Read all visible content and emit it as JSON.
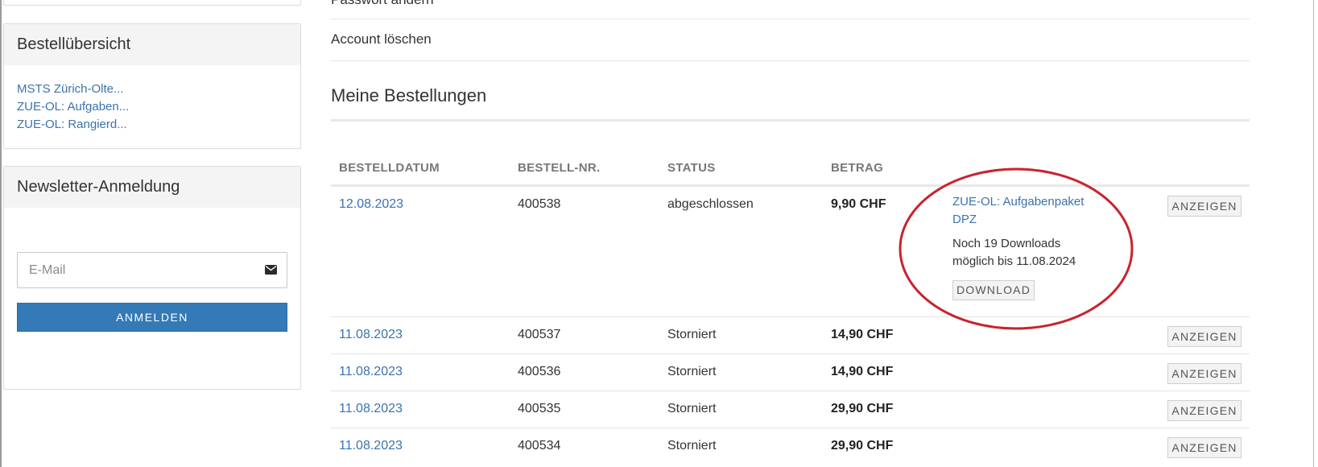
{
  "sidebar": {
    "orders_panel": {
      "title": "Bestellübersicht",
      "links": [
        "MSTS Zürich-Olte...",
        "ZUE-OL: Aufgaben...",
        "ZUE-OL: Rangierd..."
      ]
    },
    "newsletter_panel": {
      "title": "Newsletter-Anmeldung",
      "email_placeholder": "E-Mail",
      "email_value": "",
      "email_icon": "envelope-icon",
      "subscribe_label": "ANMELDEN"
    }
  },
  "account_menu": {
    "change_password": "Passwort ändern",
    "delete_account": "Account löschen"
  },
  "orders": {
    "title": "Meine Bestellungen",
    "columns": [
      "BESTELLDATUM",
      "BESTELL-NR.",
      "STATUS",
      "BETRAG"
    ],
    "rows": [
      {
        "date": "12.08.2023",
        "number": "400538",
        "status": "abgeschlossen",
        "amount": "9,90 CHF",
        "action": "ANZEIGEN",
        "product": "ZUE-OL: Aufgabenpaket DPZ",
        "download_info": "Noch 19 Downloads möglich bis 11.08.2024",
        "download_label": "DOWNLOAD"
      },
      {
        "date": "11.08.2023",
        "number": "400537",
        "status": "Storniert",
        "amount": "14,90 CHF",
        "action": "ANZEIGEN"
      },
      {
        "date": "11.08.2023",
        "number": "400536",
        "status": "Storniert",
        "amount": "14,90 CHF",
        "action": "ANZEIGEN"
      },
      {
        "date": "11.08.2023",
        "number": "400535",
        "status": "Storniert",
        "amount": "29,90 CHF",
        "action": "ANZEIGEN"
      },
      {
        "date": "11.08.2023",
        "number": "400534",
        "status": "Storniert",
        "amount": "29,90 CHF",
        "action": "ANZEIGEN"
      }
    ]
  },
  "colors": {
    "link": "#3a73b0",
    "primary_button": "#337ab7",
    "annotation_ellipse": "#c8232c"
  }
}
